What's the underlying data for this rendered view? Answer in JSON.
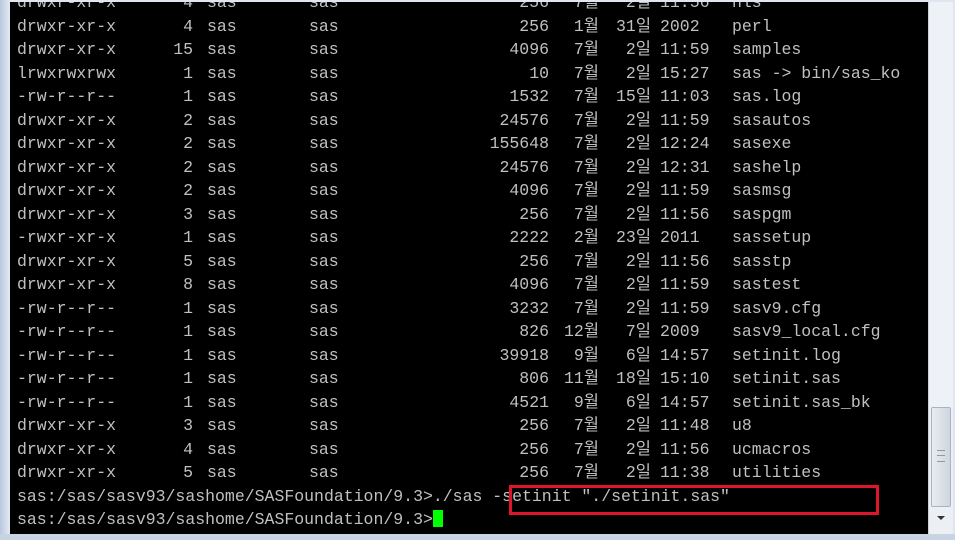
{
  "terminal": {
    "listing": [
      {
        "perm": "drwxr-xr-x",
        "links": "15",
        "owner": "sas",
        "group": "sas",
        "size": "4096",
        "month": "7월",
        "day": "2일",
        "time": "11:59",
        "name": "samples"
      },
      {
        "perm": "lrwxrwxrwx",
        "links": "1",
        "owner": "sas",
        "group": "sas",
        "size": "10",
        "month": "7월",
        "day": "2일",
        "time": "15:27",
        "name": "sas -> bin/sas_ko"
      },
      {
        "perm": "-rw-r--r--",
        "links": "1",
        "owner": "sas",
        "group": "sas",
        "size": "1532",
        "month": "7월",
        "day": "15일",
        "time": "11:03",
        "name": "sas.log"
      },
      {
        "perm": "drwxr-xr-x",
        "links": "2",
        "owner": "sas",
        "group": "sas",
        "size": "24576",
        "month": "7월",
        "day": "2일",
        "time": "11:59",
        "name": "sasautos"
      },
      {
        "perm": "drwxr-xr-x",
        "links": "2",
        "owner": "sas",
        "group": "sas",
        "size": "155648",
        "month": "7월",
        "day": "2일",
        "time": "12:24",
        "name": "sasexe"
      },
      {
        "perm": "drwxr-xr-x",
        "links": "2",
        "owner": "sas",
        "group": "sas",
        "size": "24576",
        "month": "7월",
        "day": "2일",
        "time": "12:31",
        "name": "sashelp"
      },
      {
        "perm": "drwxr-xr-x",
        "links": "2",
        "owner": "sas",
        "group": "sas",
        "size": "4096",
        "month": "7월",
        "day": "2일",
        "time": "11:59",
        "name": "sasmsg"
      },
      {
        "perm": "drwxr-xr-x",
        "links": "3",
        "owner": "sas",
        "group": "sas",
        "size": "256",
        "month": "7월",
        "day": "2일",
        "time": "11:56",
        "name": "saspgm"
      },
      {
        "perm": "-rwxr-xr-x",
        "links": "1",
        "owner": "sas",
        "group": "sas",
        "size": "2222",
        "month": "2월",
        "day": "23일",
        "time": "2011",
        "name": "sassetup"
      },
      {
        "perm": "drwxr-xr-x",
        "links": "5",
        "owner": "sas",
        "group": "sas",
        "size": "256",
        "month": "7월",
        "day": "2일",
        "time": "11:56",
        "name": "sasstp"
      },
      {
        "perm": "drwxr-xr-x",
        "links": "8",
        "owner": "sas",
        "group": "sas",
        "size": "4096",
        "month": "7월",
        "day": "2일",
        "time": "11:59",
        "name": "sastest"
      },
      {
        "perm": "-rw-r--r--",
        "links": "1",
        "owner": "sas",
        "group": "sas",
        "size": "3232",
        "month": "7월",
        "day": "2일",
        "time": "11:59",
        "name": "sasv9.cfg"
      },
      {
        "perm": "-rw-r--r--",
        "links": "1",
        "owner": "sas",
        "group": "sas",
        "size": "826",
        "month": "12월",
        "day": "7일",
        "time": "2009",
        "name": "sasv9_local.cfg"
      },
      {
        "perm": "-rw-r--r--",
        "links": "1",
        "owner": "sas",
        "group": "sas",
        "size": "39918",
        "month": "9월",
        "day": "6일",
        "time": "14:57",
        "name": "setinit.log"
      },
      {
        "perm": "-rw-r--r--",
        "links": "1",
        "owner": "sas",
        "group": "sas",
        "size": "806",
        "month": "11월",
        "day": "18일",
        "time": "15:10",
        "name": "setinit.sas"
      },
      {
        "perm": "-rw-r--r--",
        "links": "1",
        "owner": "sas",
        "group": "sas",
        "size": "4521",
        "month": "9월",
        "day": "6일",
        "time": "14:57",
        "name": "setinit.sas_bk"
      },
      {
        "perm": "drwxr-xr-x",
        "links": "3",
        "owner": "sas",
        "group": "sas",
        "size": "256",
        "month": "7월",
        "day": "2일",
        "time": "11:48",
        "name": "u8"
      },
      {
        "perm": "drwxr-xr-x",
        "links": "4",
        "owner": "sas",
        "group": "sas",
        "size": "256",
        "month": "7월",
        "day": "2일",
        "time": "11:56",
        "name": "ucmacros"
      },
      {
        "perm": "drwxr-xr-x",
        "links": "5",
        "owner": "sas",
        "group": "sas",
        "size": "256",
        "month": "7월",
        "day": "2일",
        "time": "11:38",
        "name": "utilities"
      }
    ],
    "partial_top": [
      {
        "perm": "drwxr-xr-x",
        "links": "4",
        "owner": "sas",
        "group": "sas",
        "size": "256",
        "month": "7월",
        "day": "2일",
        "time": "11:56",
        "name": "nls"
      },
      {
        "perm": "drwxr-xr-x",
        "links": "4",
        "owner": "sas",
        "group": "sas",
        "size": "256",
        "month": "1월",
        "day": "31일",
        "time": "2002",
        "name": "perl"
      }
    ],
    "command_line": {
      "prompt": "sas:/sas/sasv93/sashome/SASFoundation/9.3>",
      "command": "./sas -setinit \"./setinit.sas\""
    },
    "current_prompt": "sas:/sas/sasv93/sashome/SASFoundation/9.3>",
    "colors": {
      "background": "#000000",
      "text": "#c0c0c0",
      "cursor": "#00ff00",
      "highlight_border": "#e0152b"
    }
  },
  "scrollbar": {
    "down_arrow_icon": "chevron-down-icon"
  }
}
